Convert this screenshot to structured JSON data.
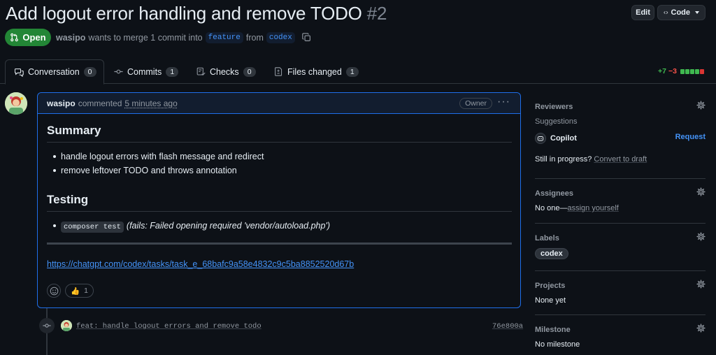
{
  "pr": {
    "title": "Add logout error handling and remove TODO",
    "number": "#2",
    "status": "Open",
    "author": "wasipo",
    "merge_text": "wants to merge 1 commit into",
    "base_branch": "feature",
    "from_text": "from",
    "head_branch": "codex"
  },
  "header_buttons": {
    "edit": "Edit",
    "code": "Code"
  },
  "tabs": [
    {
      "label": "Conversation",
      "count": "0"
    },
    {
      "label": "Commits",
      "count": "1"
    },
    {
      "label": "Checks",
      "count": "0"
    },
    {
      "label": "Files changed",
      "count": "1"
    }
  ],
  "diffstat": {
    "additions": "+7",
    "deletions": "−3",
    "blocks": [
      "add",
      "add",
      "add",
      "add",
      "del"
    ]
  },
  "comment": {
    "author": "wasipo",
    "action": "commented",
    "time": "5 minutes ago",
    "badge": "Owner",
    "summary_heading": "Summary",
    "summary_items": [
      "handle logout errors with flash message and redirect",
      "remove leftover TODO and throws annotation"
    ],
    "testing_heading": "Testing",
    "testing_code": "composer test",
    "testing_note": "(fails: Failed opening required 'vendor/autoload.php')",
    "link": "https://chatgpt.com/codex/tasks/task_e_68bafc9a58e4832c9c5ba8852520d67b",
    "reaction": {
      "emoji": "👍",
      "count": "1"
    }
  },
  "commit": {
    "message": "feat: handle logout errors and remove todo",
    "sha": "76e800a"
  },
  "sidebar": {
    "reviewers": {
      "title": "Reviewers",
      "suggestions": "Suggestions",
      "copilot": "Copilot",
      "request": "Request",
      "draft_prompt": "Still in progress?",
      "draft_link": "Convert to draft"
    },
    "assignees": {
      "title": "Assignees",
      "none": "No one—",
      "assign_link": "assign yourself"
    },
    "labels": {
      "title": "Labels",
      "items": [
        "codex"
      ]
    },
    "projects": {
      "title": "Projects",
      "value": "None yet"
    },
    "milestone": {
      "title": "Milestone",
      "value": "No milestone"
    }
  },
  "colors": {
    "accent": "#4493f8",
    "open": "#238636",
    "add": "#3fb950",
    "del": "#f85149",
    "bg": "#0d1117"
  }
}
